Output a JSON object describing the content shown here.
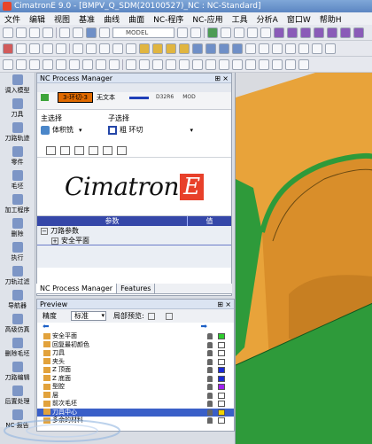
{
  "app": {
    "title": "CimatronE 9.0 - [BMPV_Q_SDM(20100527)_NC : NC-Standard]",
    "menu": [
      "文件",
      "编辑",
      "视图",
      "基准",
      "曲线",
      "曲面",
      "NC-程序",
      "NC-应用",
      "工具",
      "分析A",
      "窗口W",
      "帮助H"
    ]
  },
  "toolbar": {
    "model_label": "MODEL"
  },
  "left_toolbar": {
    "items": [
      "调入模型",
      "刀具",
      "刀路轨迹",
      "零件",
      "毛坯",
      "加工程序",
      "删除",
      "执行",
      "刀轨过滤",
      "导航器",
      "高级仿真",
      "删除毛坯",
      "刀路编辑",
      "后置处理",
      "NC 报告"
    ]
  },
  "nc_process_manager": {
    "title": "NC Process Manager",
    "pin_symbol": "⊞",
    "close_symbol": "×",
    "procedure_row": {
      "name": "3-环切-3",
      "note": "无文本",
      "tool": "D32R6",
      "mod_label": "MOD"
    },
    "main_select_label": "主选择",
    "main_select_value": "体积铣",
    "sub_select_label": "子选择",
    "sub_select_value": "粗 环切",
    "brand_name": "Cimatron",
    "brand_mark": "E",
    "params_header": {
      "col1": "参数",
      "col2": "值"
    },
    "params_rows": [
      {
        "label": "刀路参数"
      },
      {
        "label": "安全平面"
      }
    ]
  },
  "tabs": {
    "items": [
      "NC Process Manager",
      "Features"
    ]
  },
  "preview": {
    "title": "Preview",
    "precision_label": "精度",
    "precision_value": "标准",
    "partial_label": "局部预览:",
    "tree": [
      {
        "label": "安全平面",
        "color": "#2ecc2e"
      },
      {
        "label": "回复最初颜色",
        "color": "#ffffff"
      },
      {
        "label": "刀具",
        "color": "#ffffff"
      },
      {
        "label": "夹头",
        "color": "#ffffff"
      },
      {
        "label": "Z 顶面",
        "color": "#1b2bd6"
      },
      {
        "label": "Z 底面",
        "color": "#1b2bd6"
      },
      {
        "label": "型腔",
        "color": "#a020f0"
      },
      {
        "label": "层",
        "color": "#ffffff"
      },
      {
        "label": "前次毛坯",
        "color": "#ffffff"
      },
      {
        "label": "刀具中心",
        "color": "#f2d400"
      },
      {
        "label": "多余的材料",
        "color": "#ffffff"
      }
    ]
  },
  "colors": {
    "accent": "#3547a8",
    "part_orange": "#e8a33a",
    "part_green": "#2e9a3a"
  }
}
